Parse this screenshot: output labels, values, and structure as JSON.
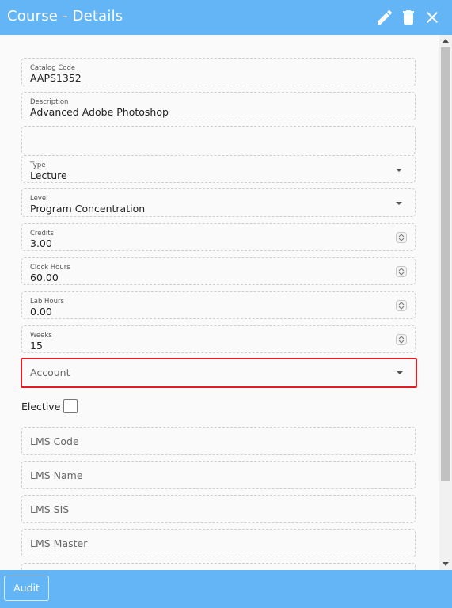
{
  "header": {
    "title": "Course - Details",
    "icons": [
      "edit-icon",
      "delete-icon",
      "close-icon"
    ],
    "color": "#64b5f6"
  },
  "form": {
    "catalog_code": {
      "label": "Catalog Code",
      "value": "AAPS1352"
    },
    "description": {
      "label": "Description",
      "value": "Advanced Adobe Photoshop"
    },
    "blank_field": {
      "value": ""
    },
    "type": {
      "label": "Type",
      "value": "Lecture"
    },
    "level": {
      "label": "Level",
      "value": "Program Concentration"
    },
    "credits": {
      "label": "Credits",
      "value": "3.00"
    },
    "clock_hours": {
      "label": "Clock Hours",
      "value": "60.00"
    },
    "lab_hours": {
      "label": "Lab Hours",
      "value": "0.00"
    },
    "weeks": {
      "label": "Weeks",
      "value": "15"
    },
    "account": {
      "placeholder": "Account",
      "highlight_color": "#e31b23"
    },
    "elective": {
      "label": "Elective",
      "checked": false
    },
    "lms_code": {
      "placeholder": "LMS Code"
    },
    "lms_name": {
      "placeholder": "LMS Name"
    },
    "lms_sis": {
      "placeholder": "LMS SIS"
    },
    "lms_master": {
      "placeholder": "LMS Master"
    }
  },
  "footer": {
    "audit_label": "Audit"
  }
}
